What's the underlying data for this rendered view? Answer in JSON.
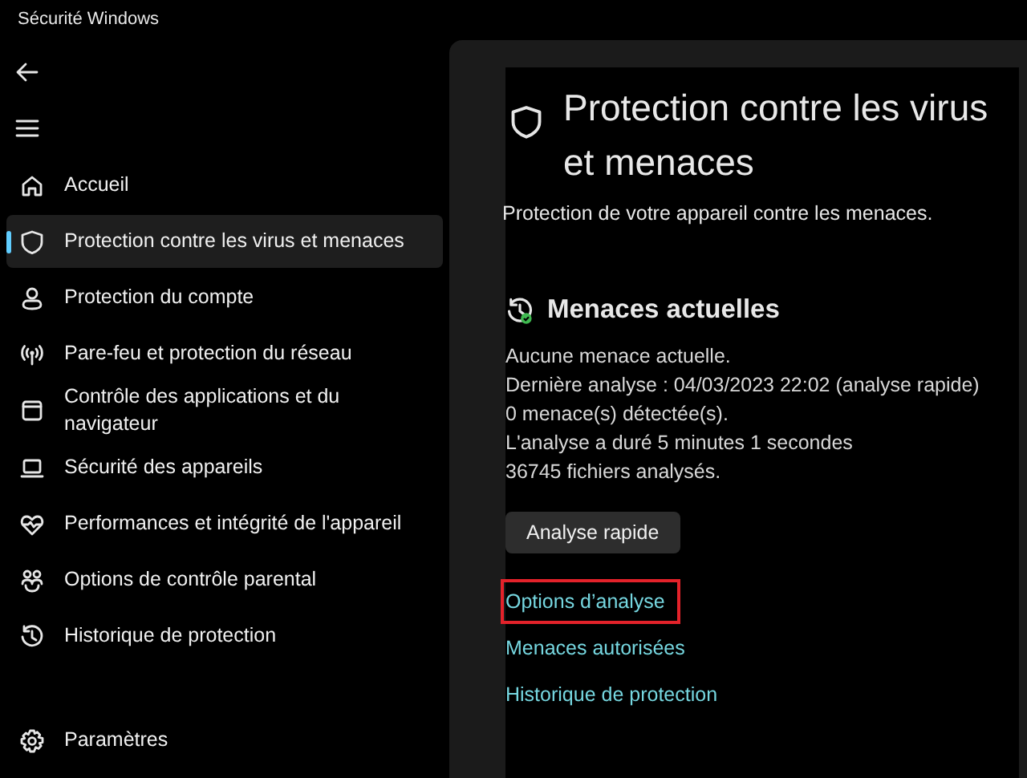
{
  "window": {
    "title": "Sécurité Windows"
  },
  "sidebar": {
    "items": [
      {
        "label": "Accueil",
        "selected": false
      },
      {
        "label": "Protection contre les virus et menaces",
        "selected": true
      },
      {
        "label": "Protection du compte",
        "selected": false
      },
      {
        "label": "Pare-feu et protection du réseau",
        "selected": false
      },
      {
        "label": "Contrôle des applications et du navigateur",
        "selected": false
      },
      {
        "label": "Sécurité des appareils",
        "selected": false
      },
      {
        "label": "Performances et intégrité de l'appareil",
        "selected": false
      },
      {
        "label": "Options de contrôle parental",
        "selected": false
      },
      {
        "label": "Historique de protection",
        "selected": false
      }
    ],
    "settings": "Paramètres"
  },
  "page": {
    "title": "Protection contre les virus et menaces",
    "subtitle": "Protection de votre appareil contre les menaces.",
    "section": {
      "heading": "Menaces actuelles",
      "lines": [
        "Aucune menace actuelle.",
        "Dernière analyse : 04/03/2023 22:02 (analyse rapide)",
        "0 menace(s) détectée(s).",
        "L'analyse a duré 5 minutes 1 secondes",
        "36745 fichiers analysés."
      ],
      "button": "Analyse rapide",
      "links": [
        {
          "label": "Options d’analyse",
          "highlighted": true
        },
        {
          "label": "Menaces autorisées",
          "highlighted": false
        },
        {
          "label": "Historique de protection",
          "highlighted": false
        }
      ]
    }
  }
}
